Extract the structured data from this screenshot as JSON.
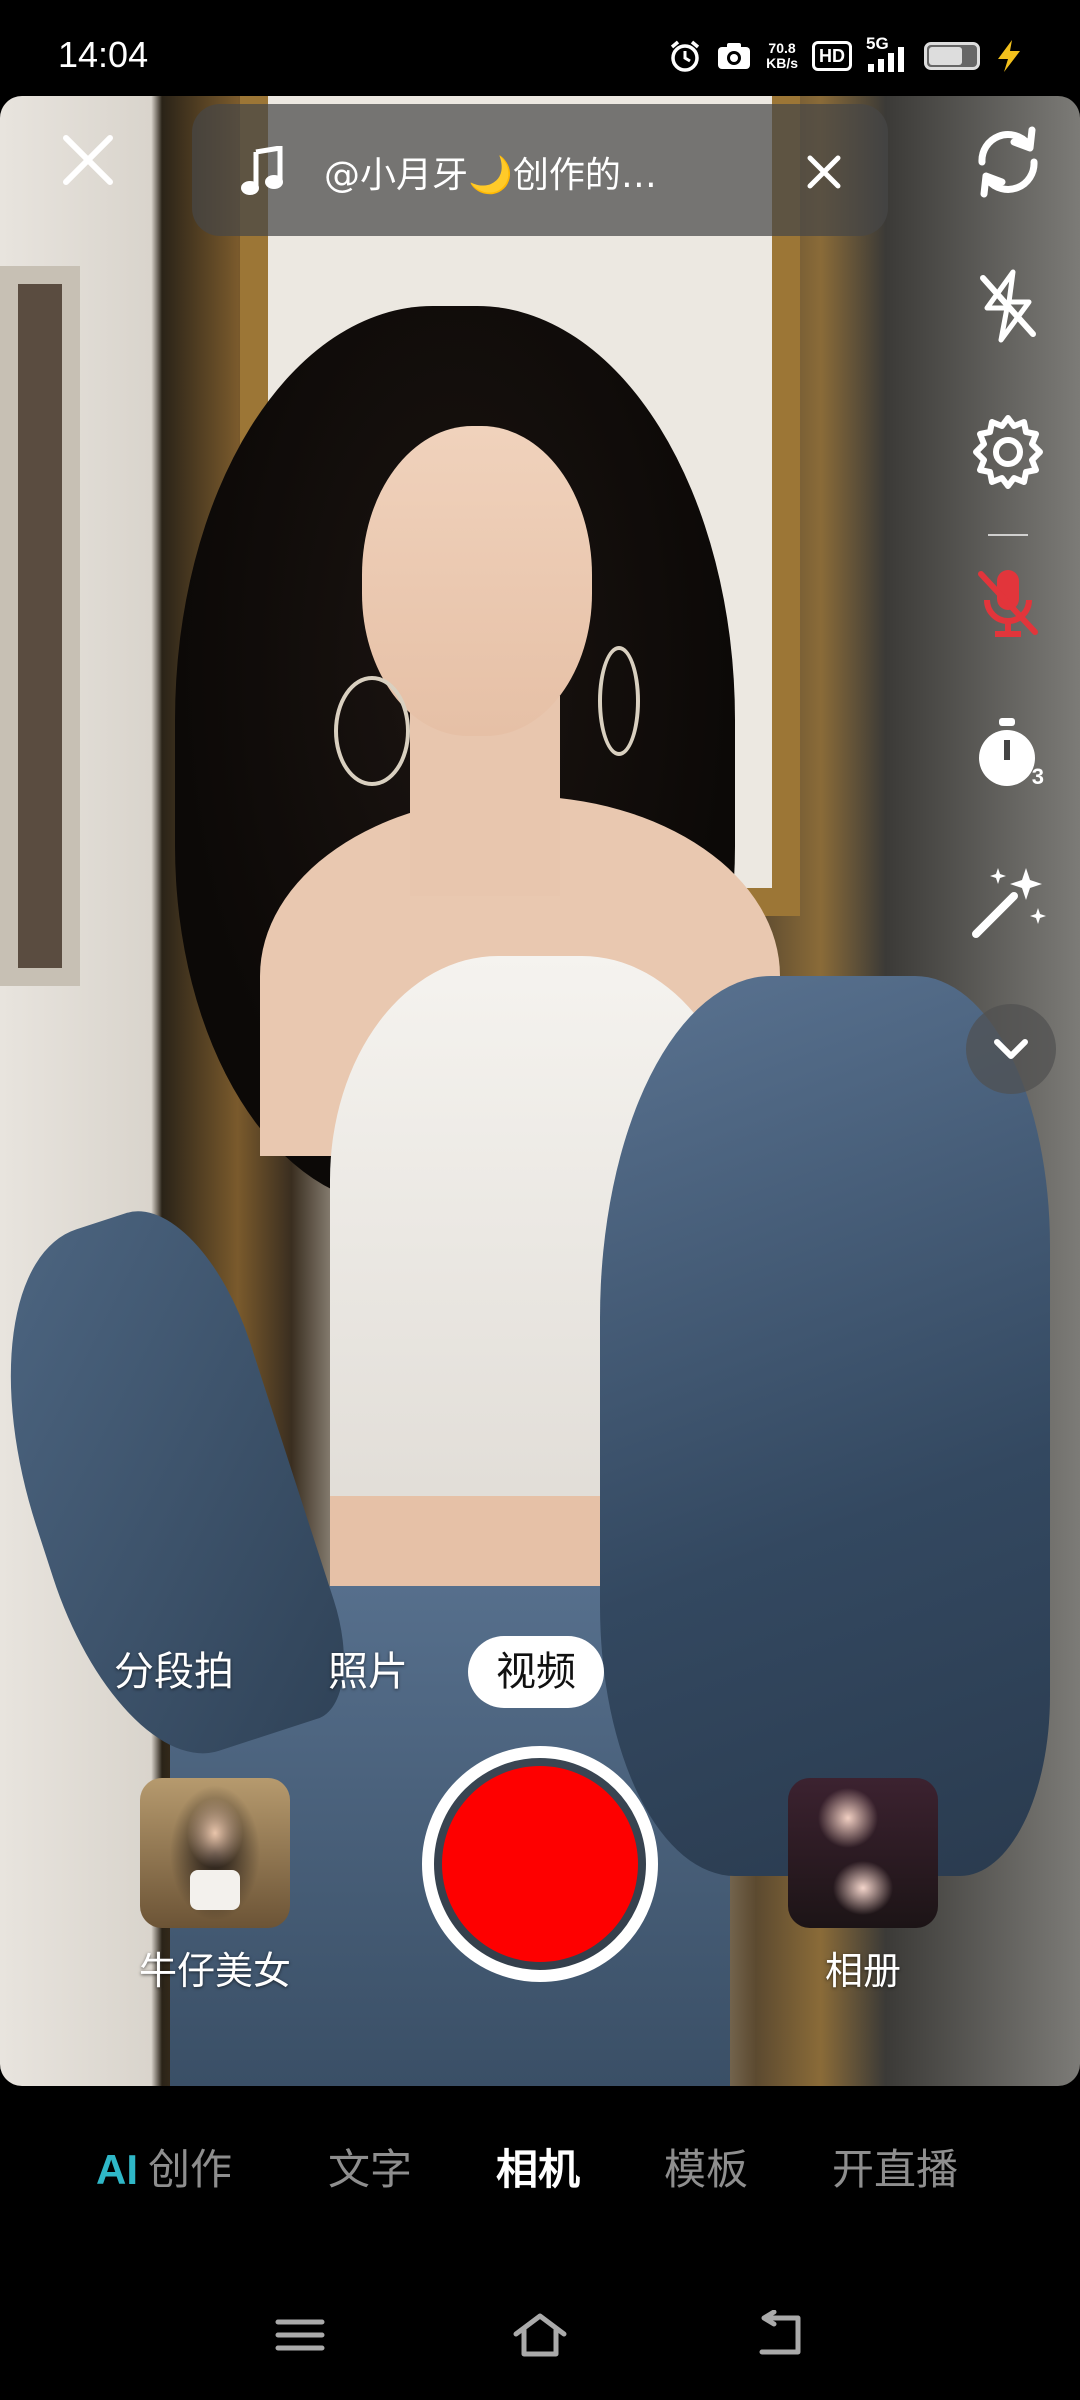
{
  "status_bar": {
    "time": "14:04",
    "net_speed_value": "70.8",
    "net_speed_unit": "KB/s",
    "hd": "HD",
    "network": "5G",
    "icons": [
      "alarm-icon",
      "camera-icon",
      "signal-icon",
      "battery-icon",
      "charging-icon"
    ],
    "battery_level": 0.65
  },
  "top_bar": {
    "close_icon": "close-icon",
    "music": {
      "icon": "music-note-icon",
      "title": "@小月牙🌙创作的…",
      "remove_icon": "close-icon"
    }
  },
  "right_tools": [
    {
      "name": "flip-camera",
      "icon": "refresh-icon"
    },
    {
      "name": "flash",
      "icon": "flash-off-icon"
    },
    {
      "name": "settings",
      "icon": "gear-icon"
    },
    {
      "name": "microphone",
      "icon": "mic-off-icon",
      "color": "#e2353b"
    },
    {
      "name": "timer",
      "icon": "timer-icon",
      "badge": "3"
    },
    {
      "name": "beauty",
      "icon": "magic-wand-icon"
    }
  ],
  "expand_icon": "chevron-down-icon",
  "modes": {
    "items": [
      "分段拍",
      "照片",
      "视频"
    ],
    "active": "视频"
  },
  "capture": {
    "effect_label": "牛仔美女",
    "album_label": "相册",
    "record_color": "#fe0000"
  },
  "bottom_tabs": {
    "ai_prefix": "AI",
    "items": [
      "创作",
      "文字",
      "相机",
      "模板",
      "开直播"
    ],
    "active": "相机",
    "ai_color": "#2fb7c7"
  },
  "nav_bar": {
    "icons": [
      "menu-icon",
      "home-icon",
      "back-icon"
    ]
  }
}
